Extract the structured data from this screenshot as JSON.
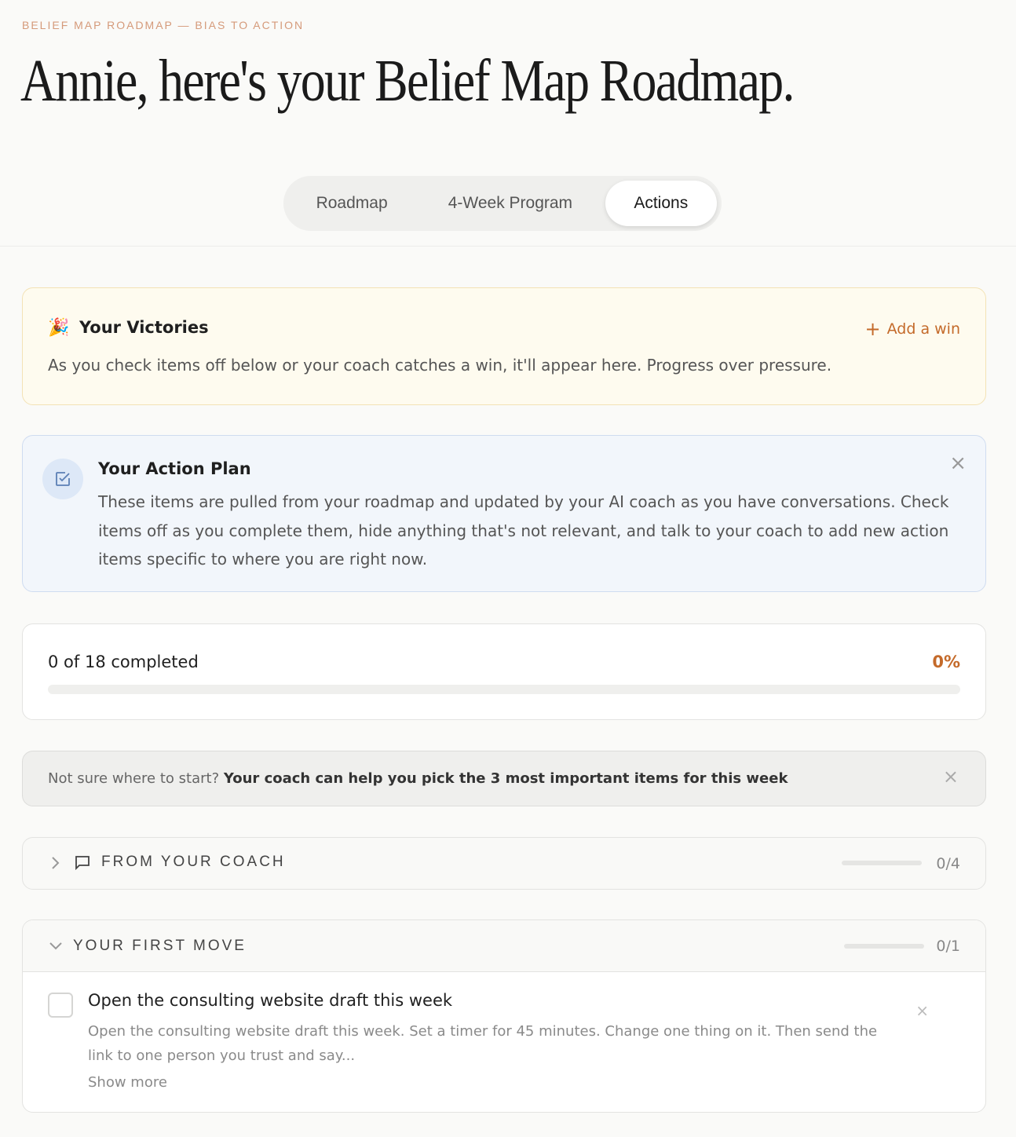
{
  "header": {
    "eyebrow": "BELIEF MAP ROADMAP — BIAS TO ACTION",
    "title": "Annie, here's your Belief Map Roadmap."
  },
  "tabs": [
    {
      "label": "Roadmap",
      "active": false
    },
    {
      "label": "4-Week Program",
      "active": false
    },
    {
      "label": "Actions",
      "active": true
    }
  ],
  "victories": {
    "icon": "party-popper-icon",
    "emoji": "🎉",
    "title": "Your Victories",
    "add_label": "Add a win",
    "text": "As you check items off below or your coach catches a win, it'll appear here. Progress over pressure."
  },
  "action_plan": {
    "icon": "checkbox-icon",
    "title": "Your Action Plan",
    "text": "These items are pulled from your roadmap and updated by your AI coach as you have conversations. Check items off as you complete them, hide anything that's not relevant, and talk to your coach to add new action items specific to where you are right now."
  },
  "progress": {
    "label": "0 of 18 completed",
    "percent_label": "0%",
    "fraction": 0
  },
  "hint": {
    "lead": "Not sure where to start?",
    "cta": "Your coach can help you pick the 3 most important items for this week"
  },
  "sections": {
    "coach": {
      "title": "FROM YOUR COACH",
      "count": "0/4",
      "fraction": 0,
      "expanded": false
    },
    "first_move": {
      "title": "YOUR FIRST MOVE",
      "count": "0/1",
      "fraction": 0,
      "expanded": true,
      "items": [
        {
          "title": "Open the consulting website draft this week",
          "description": "Open the consulting website draft this week. Set a timer for 45 minutes. Change one thing on it. Then send the link to one person you trust and say...",
          "more_label": "Show more",
          "checked": false
        }
      ]
    }
  },
  "colors": {
    "accent": "#c46a2a",
    "victories_bg": "#fefbef",
    "plan_bg": "#f2f6fb"
  }
}
